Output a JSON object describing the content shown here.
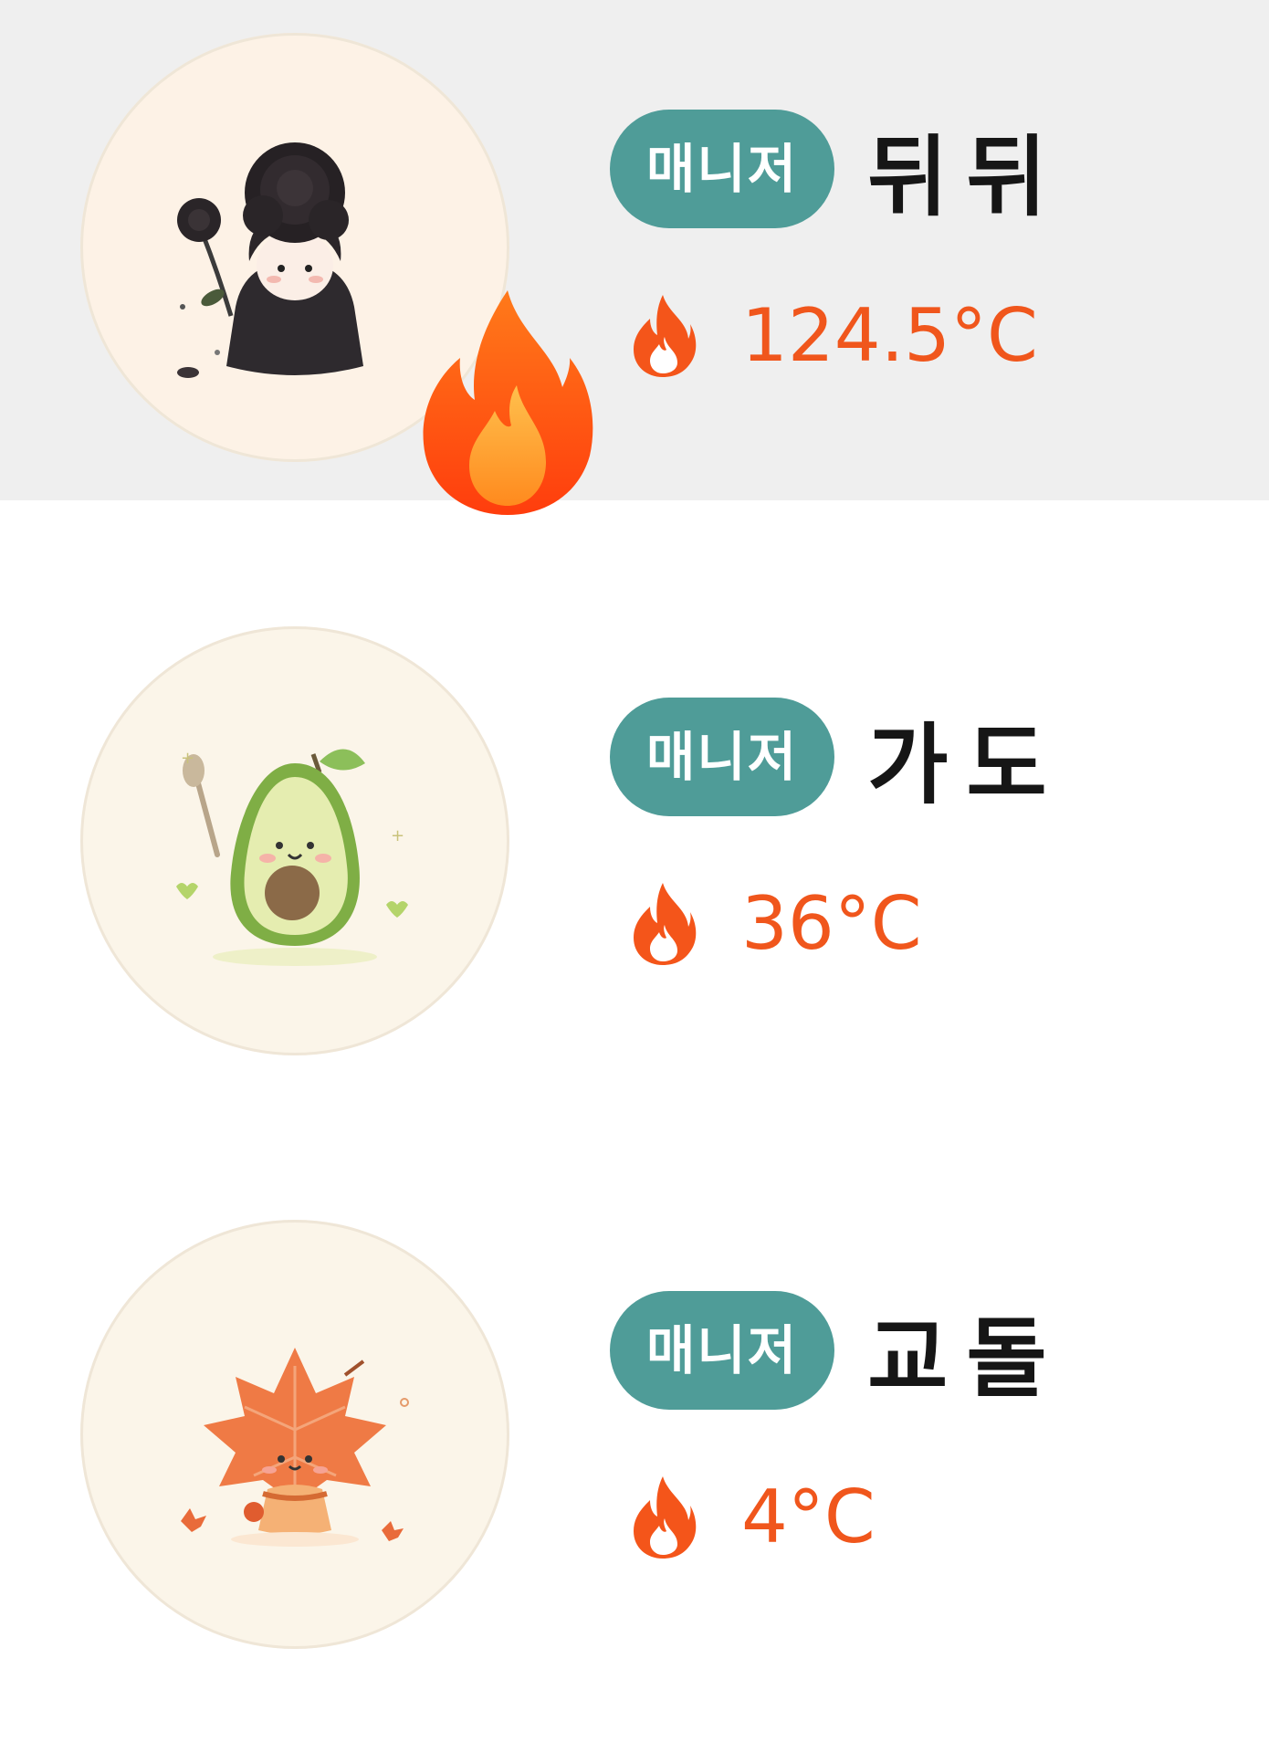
{
  "colors": {
    "role_pill": "#4f9c98",
    "temperature": "#f0561c",
    "highlight_row": "#efefef"
  },
  "managers": [
    {
      "role": "매니저",
      "name": "뒤뒤",
      "temperature": "124.5°C",
      "avatar_icon": "black-rose-doll-icon",
      "has_fire_badge": true,
      "highlighted": true
    },
    {
      "role": "매니저",
      "name": "가도",
      "temperature": "36°C",
      "avatar_icon": "avocado-character-icon",
      "has_fire_badge": false,
      "highlighted": false
    },
    {
      "role": "매니저",
      "name": "교돌",
      "temperature": "4°C",
      "avatar_icon": "maple-leaf-character-icon",
      "has_fire_badge": false,
      "highlighted": false
    }
  ]
}
